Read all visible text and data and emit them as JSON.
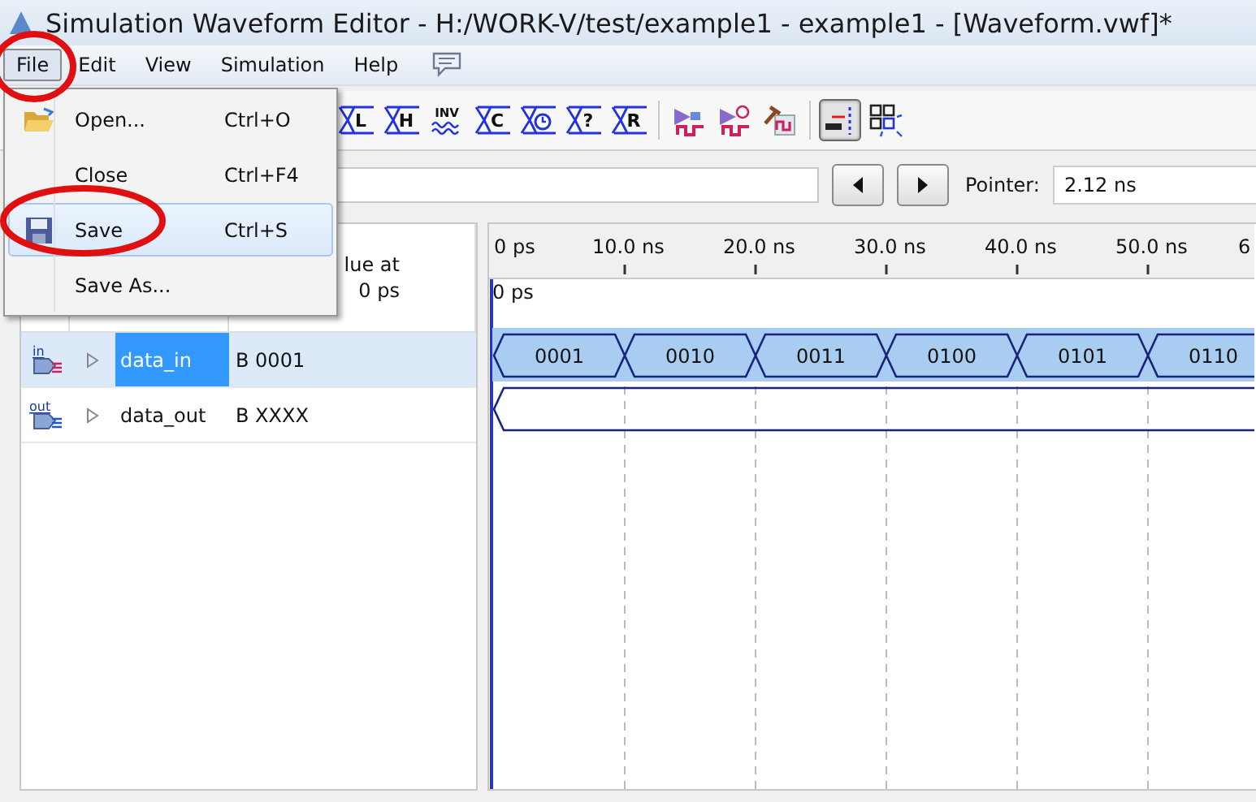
{
  "window": {
    "title": "Simulation Waveform Editor - H:/WORK-V/test/example1 - example1 - [Waveform.vwf]*"
  },
  "menubar": [
    {
      "label": "File",
      "selected": true
    },
    {
      "label": "Edit",
      "selected": false
    },
    {
      "label": "View",
      "selected": false
    },
    {
      "label": "Simulation",
      "selected": false
    },
    {
      "label": "Help",
      "selected": false
    }
  ],
  "file_menu": [
    {
      "label": "Open...",
      "shortcut": "Ctrl+O",
      "kind": "folder",
      "selected": false
    },
    {
      "label": "Close",
      "shortcut": "Ctrl+F4",
      "selected": false
    },
    {
      "label": "Save",
      "shortcut": "Ctrl+S",
      "kind": "disk",
      "selected": true
    },
    {
      "label": "Save As...",
      "selected": false
    }
  ],
  "toolbar": [
    {
      "kind": "force",
      "label": "L"
    },
    {
      "kind": "force",
      "label": "H"
    },
    {
      "kind": "invert",
      "label": "INV"
    },
    {
      "kind": "force",
      "label": "C"
    },
    {
      "kind": "clock"
    },
    {
      "kind": "force",
      "label": "?"
    },
    {
      "kind": "force",
      "label": "R"
    },
    {
      "kind": "run"
    },
    {
      "kind": "run-timing"
    },
    {
      "kind": "build"
    },
    {
      "kind": "snap",
      "selected": true
    },
    {
      "kind": "grid"
    }
  ],
  "pointer": {
    "label": "Pointer:",
    "value": "2.12 ns"
  },
  "table": {
    "value_header": [
      "lue at",
      "0 ps"
    ],
    "rows": [
      {
        "icon_label": "in",
        "kind": "input",
        "name": "data_in",
        "value": "B 0001",
        "selected": true,
        "expanded": false,
        "segments": [
          "0001",
          "0010",
          "0011",
          "0100",
          "0101",
          "0110"
        ]
      },
      {
        "icon_label": "out",
        "kind": "output",
        "name": "data_out",
        "value": "B XXXX",
        "selected": false,
        "expanded": false
      }
    ]
  },
  "timeline": {
    "ticks": [
      "0 ps",
      "10.0 ns",
      "20.0 ns",
      "30.0 ns",
      "40.0 ns",
      "50.0 ns",
      "6"
    ],
    "cursor": "0 ps"
  }
}
